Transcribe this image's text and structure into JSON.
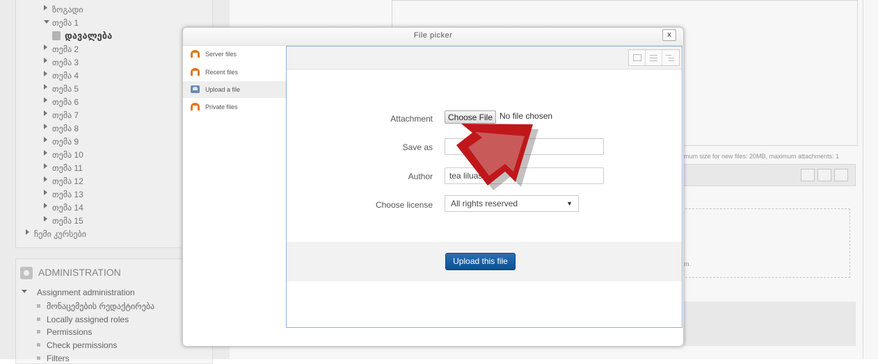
{
  "background": {
    "nav_tree": [
      {
        "label": "ზოგადი",
        "kind": "collapsed"
      },
      {
        "label": "თემა 1",
        "kind": "expanded"
      },
      {
        "label": "დავალება",
        "kind": "page"
      },
      {
        "label": "თემა 2",
        "kind": "collapsed"
      },
      {
        "label": "თემა 3",
        "kind": "collapsed"
      },
      {
        "label": "თემა 4",
        "kind": "collapsed"
      },
      {
        "label": "თემა 5",
        "kind": "collapsed"
      },
      {
        "label": "თემა 6",
        "kind": "collapsed"
      },
      {
        "label": "თემა 7",
        "kind": "collapsed"
      },
      {
        "label": "თემა 8",
        "kind": "collapsed"
      },
      {
        "label": "თემა 9",
        "kind": "collapsed"
      },
      {
        "label": "თემა 10",
        "kind": "collapsed"
      },
      {
        "label": "თემა 11",
        "kind": "collapsed"
      },
      {
        "label": "თემა 12",
        "kind": "collapsed"
      },
      {
        "label": "თემა 13",
        "kind": "collapsed"
      },
      {
        "label": "თემა 14",
        "kind": "collapsed"
      },
      {
        "label": "თემა 15",
        "kind": "collapsed"
      },
      {
        "label": "ჩემი კურსები",
        "kind": "collapsed"
      }
    ],
    "admin": {
      "title": "ADMINISTRATION",
      "section": "Assignment administration",
      "items": [
        "მონაცემების რედაქტირება",
        "Locally assigned roles",
        "Permissions",
        "Check permissions",
        "Filters"
      ]
    },
    "size_note": "mum size for new files: 20MB, maximum attachments: 1",
    "drop_note": "m."
  },
  "dialog": {
    "title": "File picker",
    "close_label": "x",
    "repositories": [
      {
        "label": "Server files",
        "icon": "moodle-icon",
        "active": false
      },
      {
        "label": "Recent files",
        "icon": "moodle-icon",
        "active": false
      },
      {
        "label": "Upload a file",
        "icon": "upload-icon",
        "active": true
      },
      {
        "label": "Private files",
        "icon": "moodle-icon",
        "active": false
      }
    ],
    "view_modes": [
      "icons-view-icon",
      "list-view-icon",
      "tree-view-icon"
    ],
    "form": {
      "attachment_label": "Attachment",
      "choose_file_label": "Choose File",
      "no_file_text": "No file chosen",
      "save_as_label": "Save as",
      "save_as_value": "",
      "author_label": "Author",
      "author_value": "tea liluash",
      "license_label": "Choose license",
      "license_value": "All rights reserved"
    },
    "upload_button_label": "Upload this file"
  },
  "colors": {
    "upload_button": "#0d4f94",
    "annotation_arrow": "#c0171b",
    "panel_border": "#8fb2d8"
  }
}
